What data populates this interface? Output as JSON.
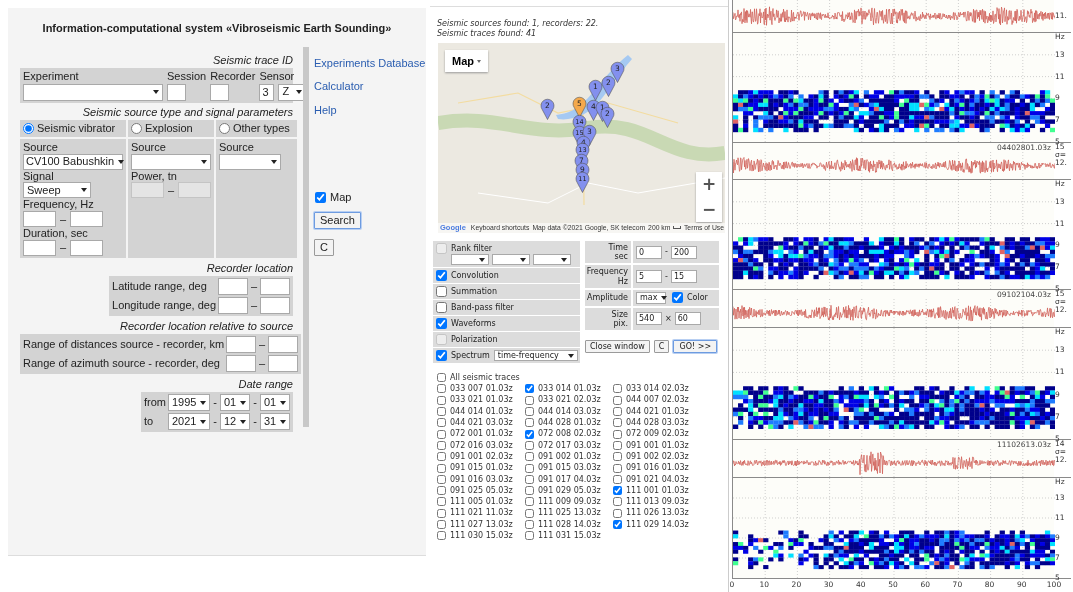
{
  "title": "Information-computational system «Vibroseismic Earth Sounding»",
  "trace_id": {
    "heading": "Seismic trace ID",
    "experiment": "Experiment",
    "session": "Session",
    "recorder": "Recorder",
    "sensor": {
      "label": "Sensor",
      "value": "3",
      "component": "Z"
    }
  },
  "source": {
    "heading": "Seismic source type and signal parameters",
    "types": [
      {
        "label": "Seismic vibrator",
        "selected": true,
        "fields": [
          {
            "kind": "select",
            "label": "Source",
            "value": "CV100 Babushkin"
          },
          {
            "kind": "select",
            "label": "Signal",
            "value": "Sweep"
          },
          {
            "kind": "range",
            "label": "Frequency, Hz",
            "separator": "–",
            "disabled": false
          },
          {
            "kind": "range",
            "label": "Duration, sec",
            "separator": "–",
            "disabled": false
          }
        ]
      },
      {
        "label": "Explosion",
        "selected": false,
        "fields": [
          {
            "kind": "select",
            "label": "Source"
          },
          {
            "kind": "range",
            "label": "Power, tn",
            "separator": "–",
            "disabled": true
          }
        ]
      },
      {
        "label": "Other types",
        "selected": false,
        "fields": [
          {
            "kind": "select",
            "label": "Source"
          }
        ]
      }
    ]
  },
  "recorder_location": {
    "heading": "Recorder location",
    "rows": [
      {
        "label": "Latitude range, deg",
        "separator": "–"
      },
      {
        "label": "Longitude range, deg",
        "separator": "–"
      }
    ]
  },
  "relative_location": {
    "heading": "Recorder location relative to source",
    "rows": [
      {
        "label": "Range of distances source - recorder, km",
        "separator": "–"
      },
      {
        "label": "Range of azimuth source - recorder, deg",
        "separator": "–"
      }
    ]
  },
  "date_range": {
    "heading": "Date range",
    "rows": [
      {
        "label": "from",
        "year": "1995",
        "month": "01",
        "day": "01",
        "separators": [
          "-",
          "-"
        ]
      },
      {
        "label": "to",
        "year": "2021",
        "month": "12",
        "day": "31",
        "separators": [
          "-",
          "-"
        ]
      }
    ]
  },
  "links": [
    "Experiments Database",
    "Calculator",
    "Help"
  ],
  "map_toggle": {
    "label": "Map",
    "checked": true
  },
  "search_buttons": [
    {
      "label": "Search",
      "default": true
    },
    {
      "label": "C",
      "default": false
    }
  ],
  "results": [
    "Seismic sources found: 1, recorders: 22.",
    "Seismic traces found: 41"
  ],
  "map": {
    "type_button": "Map",
    "zoom_in": "+",
    "zoom_out": "−",
    "logo": "Google",
    "markers": [
      {
        "label": "3",
        "color": "#8390ee"
      },
      {
        "label": "2",
        "color": "#8390ee"
      },
      {
        "label": "1",
        "color": "#8390ee"
      },
      {
        "label": "2",
        "color": "#8390ee"
      },
      {
        "label": "5",
        "color": "#f4a94c"
      },
      {
        "label": "4",
        "color": "#8390ee"
      },
      {
        "label": "1",
        "color": "#8390ee"
      },
      {
        "label": "2",
        "color": "#8390ee"
      },
      {
        "label": "14",
        "color": "#8390ee"
      },
      {
        "label": "15",
        "color": "#8390ee"
      },
      {
        "label": "3",
        "color": "#8390ee"
      },
      {
        "label": "4",
        "color": "#8390ee"
      },
      {
        "label": "13",
        "color": "#8390ee"
      },
      {
        "label": "7",
        "color": "#8390ee"
      },
      {
        "label": "9",
        "color": "#8390ee"
      },
      {
        "label": "11",
        "color": "#8390ee"
      }
    ],
    "attribution": [
      {
        "kind": "link",
        "text": "Keyboard shortcuts"
      },
      {
        "kind": "text",
        "text": "Map data ©2021 Google, SK telecom"
      },
      {
        "kind": "scale",
        "text": "200 km"
      },
      {
        "kind": "link",
        "text": "Terms of Use"
      }
    ]
  },
  "filters": [
    {
      "kind": "rank",
      "label": "Rank filter",
      "checked": false,
      "disabled": true
    },
    {
      "kind": "plain",
      "label": "Convolution",
      "checked": true,
      "disabled": false
    },
    {
      "kind": "plain",
      "label": "Summation",
      "checked": false,
      "disabled": false
    },
    {
      "kind": "plain",
      "label": "Band-pass filter",
      "checked": false,
      "disabled": false
    },
    {
      "kind": "plain",
      "label": "Waveforms",
      "checked": true,
      "disabled": false
    },
    {
      "kind": "plain",
      "label": "Polarization",
      "checked": false,
      "disabled": true
    },
    {
      "kind": "select",
      "label": "Spectrum",
      "checked": true,
      "disabled": false,
      "value": "time-frequency"
    }
  ],
  "display": [
    {
      "kind": "range",
      "label_lines": [
        "Time",
        "sec"
      ],
      "from": "0",
      "to": "200",
      "separator": "-"
    },
    {
      "kind": "range",
      "label_lines": [
        "Frequency",
        "Hz"
      ],
      "from": "5",
      "to": "15",
      "separator": "-"
    },
    {
      "kind": "amplitude",
      "label_lines": [
        "Amplitude"
      ],
      "value": "max",
      "toggle": {
        "label": "Color",
        "checked": true
      }
    },
    {
      "kind": "range",
      "label_lines": [
        "Size",
        "pix."
      ],
      "from": "540",
      "to": "60",
      "separator": "×"
    }
  ],
  "action_buttons": [
    {
      "label": "Close window",
      "default": false
    },
    {
      "label": "C",
      "default": false
    },
    {
      "label": "GO! >>",
      "default": true
    }
  ],
  "all_traces": {
    "label": "All seismic traces",
    "checked": false
  },
  "traces": [
    {
      "label": "033 007 01.03z",
      "checked": false
    },
    {
      "label": "033 014 01.03z",
      "checked": true
    },
    {
      "label": "033 014 02.03z",
      "checked": false
    },
    {
      "label": "033 021 01.03z",
      "checked": false
    },
    {
      "label": "033 021 02.03z",
      "checked": false
    },
    {
      "label": "044 007 02.03z",
      "checked": false
    },
    {
      "label": "044 014 01.03z",
      "checked": false
    },
    {
      "label": "044 014 03.03z",
      "checked": false
    },
    {
      "label": "044 021 01.03z",
      "checked": false
    },
    {
      "label": "044 021 03.03z",
      "checked": false
    },
    {
      "label": "044 028 01.03z",
      "checked": false
    },
    {
      "label": "044 028 03.03z",
      "checked": false
    },
    {
      "label": "072 001 01.03z",
      "checked": false
    },
    {
      "label": "072 008 02.03z",
      "checked": true
    },
    {
      "label": "072 009 02.03z",
      "checked": false
    },
    {
      "label": "072 016 03.03z",
      "checked": false
    },
    {
      "label": "072 017 03.03z",
      "checked": false
    },
    {
      "label": "091 001 01.03z",
      "checked": false
    },
    {
      "label": "091 001 02.03z",
      "checked": false
    },
    {
      "label": "091 002 01.03z",
      "checked": false
    },
    {
      "label": "091 002 02.03z",
      "checked": false
    },
    {
      "label": "091 015 01.03z",
      "checked": false
    },
    {
      "label": "091 015 03.03z",
      "checked": false
    },
    {
      "label": "091 016 01.03z",
      "checked": false
    },
    {
      "label": "091 016 03.03z",
      "checked": false
    },
    {
      "label": "091 017 04.03z",
      "checked": false
    },
    {
      "label": "091 021 04.03z",
      "checked": false
    },
    {
      "label": "091 025 05.03z",
      "checked": false
    },
    {
      "label": "091 029 05.03z",
      "checked": false
    },
    {
      "label": "111 001 01.03z",
      "checked": true
    },
    {
      "label": "111 005 01.03z",
      "checked": false
    },
    {
      "label": "111 009 09.03z",
      "checked": false
    },
    {
      "label": "111 013 09.03z",
      "checked": false
    },
    {
      "label": "111 021 11.03z",
      "checked": false
    },
    {
      "label": "111 025 13.03z",
      "checked": false
    },
    {
      "label": "111 026 13.03z",
      "checked": false
    },
    {
      "label": "111 027 13.03z",
      "checked": false
    },
    {
      "label": "111 028 14.03z",
      "checked": false
    },
    {
      "label": "111 029 14.03z",
      "checked": true
    },
    {
      "label": "111 030 15.03z",
      "checked": false
    },
    {
      "label": "111 031 15.03z",
      "checked": false
    }
  ],
  "plots": [
    {
      "kind": "waveform",
      "labels": [
        "11."
      ]
    },
    {
      "kind": "spectrogram",
      "ticks": [
        "Hz",
        "13",
        "11",
        "9",
        "7",
        "5"
      ]
    },
    {
      "kind": "waveform",
      "trace_id": "04402801.03z",
      "labels": [
        "15",
        "σ=",
        "12."
      ]
    },
    {
      "kind": "spectrogram",
      "ticks": [
        "Hz",
        "13",
        "11",
        "9",
        "7",
        "5"
      ]
    },
    {
      "kind": "waveform",
      "trace_id": "09102104.03z",
      "labels": [
        "15",
        "σ=",
        "12."
      ]
    },
    {
      "kind": "spectrogram",
      "ticks": [
        "Hz",
        "13",
        "11",
        "9",
        "7",
        "5"
      ]
    },
    {
      "kind": "waveform",
      "trace_id": "11102613.03z",
      "labels": [
        "14",
        "σ=",
        "12."
      ]
    },
    {
      "kind": "spectrogram",
      "ticks": [
        "Hz",
        "13",
        "11",
        "9",
        "7",
        "5"
      ]
    }
  ],
  "x_ticks": [
    "0",
    "10",
    "20",
    "30",
    "40",
    "50",
    "60",
    "70",
    "80",
    "90",
    "100"
  ]
}
